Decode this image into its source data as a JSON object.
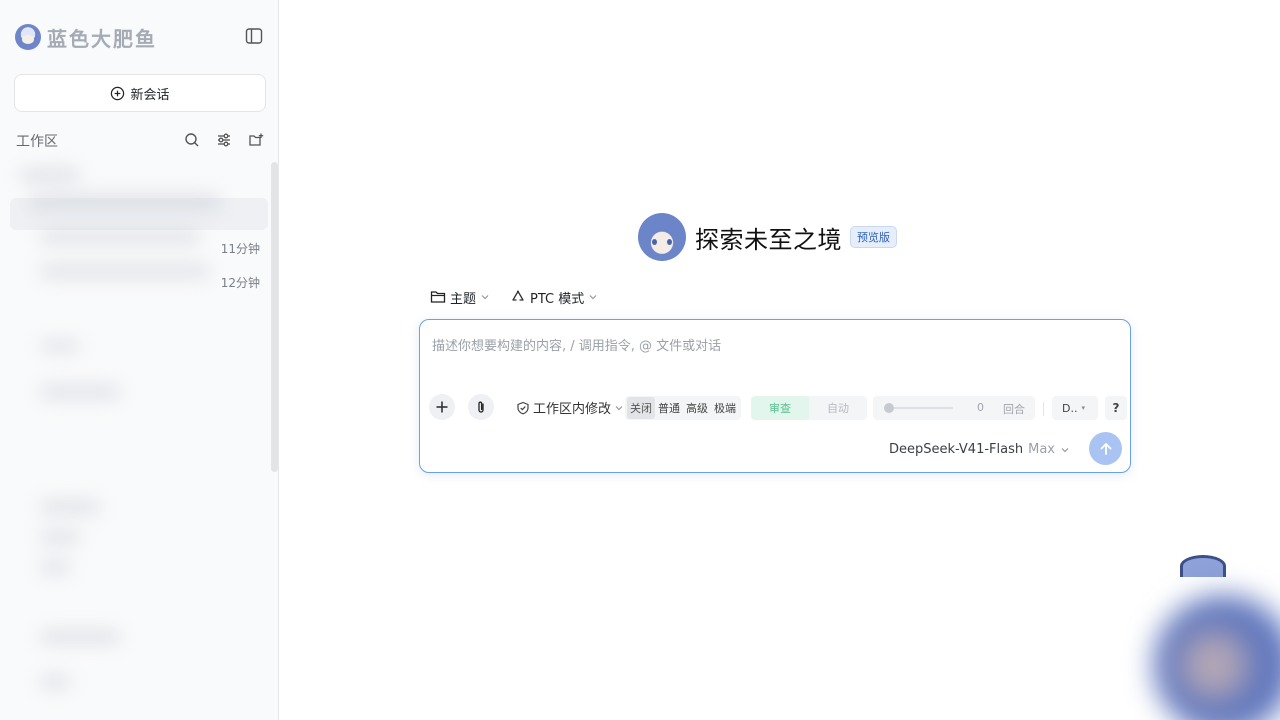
{
  "sidebar": {
    "brand_name": "蓝色大肥鱼",
    "new_chat_label": "新会话",
    "workspace_title": "工作区",
    "conversations": [
      {
        "time": "11分钟"
      },
      {
        "time": "12分钟"
      }
    ]
  },
  "hero": {
    "title": "探索未至之境",
    "badge": "预览版"
  },
  "options": {
    "topic_label": "主题",
    "mode_label": "PTC 模式"
  },
  "composer": {
    "placeholder": "描述你想要构建的内容, / 调用指令, @ 文件或对话",
    "permission_label": "工作区内修改",
    "thinking_levels": [
      "关闭",
      "普通",
      "高级",
      "极端"
    ],
    "thinking_selected": "关闭",
    "review_options": [
      "审查",
      "自动"
    ],
    "review_selected": "审查",
    "rounds_value": "0",
    "rounds_unit": "回合",
    "d_select_value": "D..",
    "help_label": "?",
    "model_name": "DeepSeek-V41-Flash",
    "model_tier": "Max"
  },
  "colors": {
    "accent_border": "#6aa0e6",
    "send_button": "#a9c4f3",
    "badge_bg": "#e6eefb",
    "review_on": "#57c38f"
  }
}
